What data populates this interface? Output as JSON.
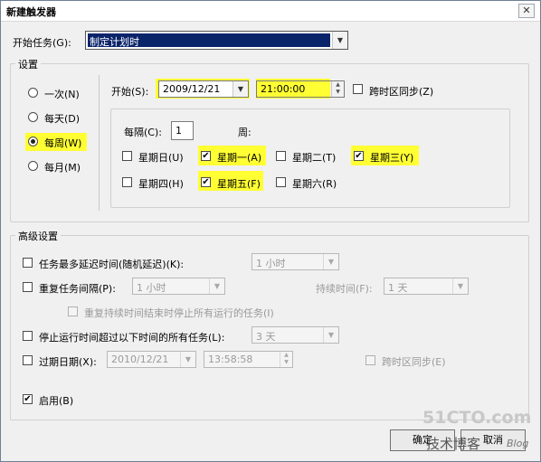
{
  "window": {
    "title": "新建触发器",
    "close_glyph": "✕"
  },
  "start_task": {
    "label": "开始任务(G):",
    "value": "制定计划时"
  },
  "settings": {
    "group_title": "设置",
    "schedule_options": [
      {
        "label": "一次(N)",
        "selected": false
      },
      {
        "label": "每天(D)",
        "selected": false
      },
      {
        "label": "每周(W)",
        "selected": true
      },
      {
        "label": "每月(M)",
        "selected": false
      }
    ],
    "start_label": "开始(S):",
    "start_date": "2009/12/21",
    "start_time": "21:00:00",
    "sync_timezone_label": "跨时区同步(Z)",
    "sync_timezone_checked": false,
    "every_label": "每隔(C):",
    "every_value": "1",
    "weeks_label": "周:",
    "weekdays": [
      {
        "label": "星期日(U)",
        "checked": false
      },
      {
        "label": "星期一(A)",
        "checked": true
      },
      {
        "label": "星期二(T)",
        "checked": false
      },
      {
        "label": "星期三(Y)",
        "checked": true
      },
      {
        "label": "星期四(H)",
        "checked": false
      },
      {
        "label": "星期五(F)",
        "checked": true
      },
      {
        "label": "星期六(R)",
        "checked": false
      }
    ]
  },
  "advanced": {
    "group_title": "高级设置",
    "delay_label": "任务最多延迟时间(随机延迟)(K):",
    "delay_value": "1 小时",
    "repeat_label": "重复任务间隔(P):",
    "repeat_value": "1 小时",
    "duration_label": "持续时间(F):",
    "duration_value": "1 天",
    "stop_at_end_label": "重复持续时间结束时停止所有运行的任务(I)",
    "stop_longer_label": "停止运行时间超过以下时间的所有任务(L):",
    "stop_longer_value": "3 天",
    "expire_label": "过期日期(X):",
    "expire_date": "2010/12/21",
    "expire_time": "13:58:58",
    "expire_sync_label": "跨时区同步(E)",
    "enabled_label": "启用(B)",
    "enabled_checked": true
  },
  "buttons": {
    "ok": "确定",
    "cancel": "取消"
  },
  "watermark": {
    "site": "51CTO.com",
    "sub": "技术博客",
    "blog": "Blog"
  },
  "colors": {
    "highlight": "#ffff33",
    "selection": "#0a246a"
  },
  "icons": {
    "check": "✔",
    "dropdown": "▼",
    "spin_up": "▲",
    "spin_down": "▼"
  }
}
